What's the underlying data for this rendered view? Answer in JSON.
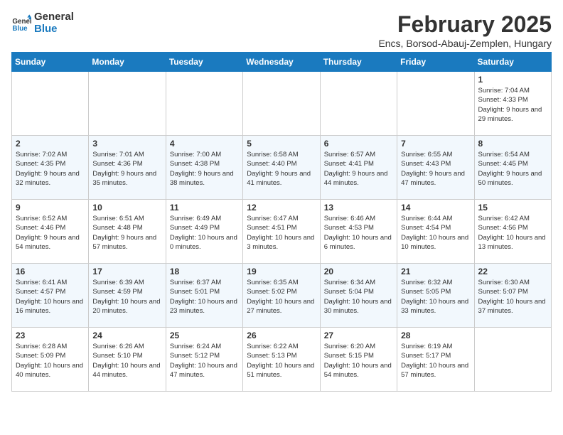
{
  "logo": {
    "line1": "General",
    "line2": "Blue"
  },
  "title": "February 2025",
  "location": "Encs, Borsod-Abauj-Zemplen, Hungary",
  "headers": [
    "Sunday",
    "Monday",
    "Tuesday",
    "Wednesday",
    "Thursday",
    "Friday",
    "Saturday"
  ],
  "weeks": [
    [
      {
        "day": "",
        "info": ""
      },
      {
        "day": "",
        "info": ""
      },
      {
        "day": "",
        "info": ""
      },
      {
        "day": "",
        "info": ""
      },
      {
        "day": "",
        "info": ""
      },
      {
        "day": "",
        "info": ""
      },
      {
        "day": "1",
        "info": "Sunrise: 7:04 AM\nSunset: 4:33 PM\nDaylight: 9 hours and 29 minutes."
      }
    ],
    [
      {
        "day": "2",
        "info": "Sunrise: 7:02 AM\nSunset: 4:35 PM\nDaylight: 9 hours and 32 minutes."
      },
      {
        "day": "3",
        "info": "Sunrise: 7:01 AM\nSunset: 4:36 PM\nDaylight: 9 hours and 35 minutes."
      },
      {
        "day": "4",
        "info": "Sunrise: 7:00 AM\nSunset: 4:38 PM\nDaylight: 9 hours and 38 minutes."
      },
      {
        "day": "5",
        "info": "Sunrise: 6:58 AM\nSunset: 4:40 PM\nDaylight: 9 hours and 41 minutes."
      },
      {
        "day": "6",
        "info": "Sunrise: 6:57 AM\nSunset: 4:41 PM\nDaylight: 9 hours and 44 minutes."
      },
      {
        "day": "7",
        "info": "Sunrise: 6:55 AM\nSunset: 4:43 PM\nDaylight: 9 hours and 47 minutes."
      },
      {
        "day": "8",
        "info": "Sunrise: 6:54 AM\nSunset: 4:45 PM\nDaylight: 9 hours and 50 minutes."
      }
    ],
    [
      {
        "day": "9",
        "info": "Sunrise: 6:52 AM\nSunset: 4:46 PM\nDaylight: 9 hours and 54 minutes."
      },
      {
        "day": "10",
        "info": "Sunrise: 6:51 AM\nSunset: 4:48 PM\nDaylight: 9 hours and 57 minutes."
      },
      {
        "day": "11",
        "info": "Sunrise: 6:49 AM\nSunset: 4:49 PM\nDaylight: 10 hours and 0 minutes."
      },
      {
        "day": "12",
        "info": "Sunrise: 6:47 AM\nSunset: 4:51 PM\nDaylight: 10 hours and 3 minutes."
      },
      {
        "day": "13",
        "info": "Sunrise: 6:46 AM\nSunset: 4:53 PM\nDaylight: 10 hours and 6 minutes."
      },
      {
        "day": "14",
        "info": "Sunrise: 6:44 AM\nSunset: 4:54 PM\nDaylight: 10 hours and 10 minutes."
      },
      {
        "day": "15",
        "info": "Sunrise: 6:42 AM\nSunset: 4:56 PM\nDaylight: 10 hours and 13 minutes."
      }
    ],
    [
      {
        "day": "16",
        "info": "Sunrise: 6:41 AM\nSunset: 4:57 PM\nDaylight: 10 hours and 16 minutes."
      },
      {
        "day": "17",
        "info": "Sunrise: 6:39 AM\nSunset: 4:59 PM\nDaylight: 10 hours and 20 minutes."
      },
      {
        "day": "18",
        "info": "Sunrise: 6:37 AM\nSunset: 5:01 PM\nDaylight: 10 hours and 23 minutes."
      },
      {
        "day": "19",
        "info": "Sunrise: 6:35 AM\nSunset: 5:02 PM\nDaylight: 10 hours and 27 minutes."
      },
      {
        "day": "20",
        "info": "Sunrise: 6:34 AM\nSunset: 5:04 PM\nDaylight: 10 hours and 30 minutes."
      },
      {
        "day": "21",
        "info": "Sunrise: 6:32 AM\nSunset: 5:05 PM\nDaylight: 10 hours and 33 minutes."
      },
      {
        "day": "22",
        "info": "Sunrise: 6:30 AM\nSunset: 5:07 PM\nDaylight: 10 hours and 37 minutes."
      }
    ],
    [
      {
        "day": "23",
        "info": "Sunrise: 6:28 AM\nSunset: 5:09 PM\nDaylight: 10 hours and 40 minutes."
      },
      {
        "day": "24",
        "info": "Sunrise: 6:26 AM\nSunset: 5:10 PM\nDaylight: 10 hours and 44 minutes."
      },
      {
        "day": "25",
        "info": "Sunrise: 6:24 AM\nSunset: 5:12 PM\nDaylight: 10 hours and 47 minutes."
      },
      {
        "day": "26",
        "info": "Sunrise: 6:22 AM\nSunset: 5:13 PM\nDaylight: 10 hours and 51 minutes."
      },
      {
        "day": "27",
        "info": "Sunrise: 6:20 AM\nSunset: 5:15 PM\nDaylight: 10 hours and 54 minutes."
      },
      {
        "day": "28",
        "info": "Sunrise: 6:19 AM\nSunset: 5:17 PM\nDaylight: 10 hours and 57 minutes."
      },
      {
        "day": "",
        "info": ""
      }
    ]
  ]
}
